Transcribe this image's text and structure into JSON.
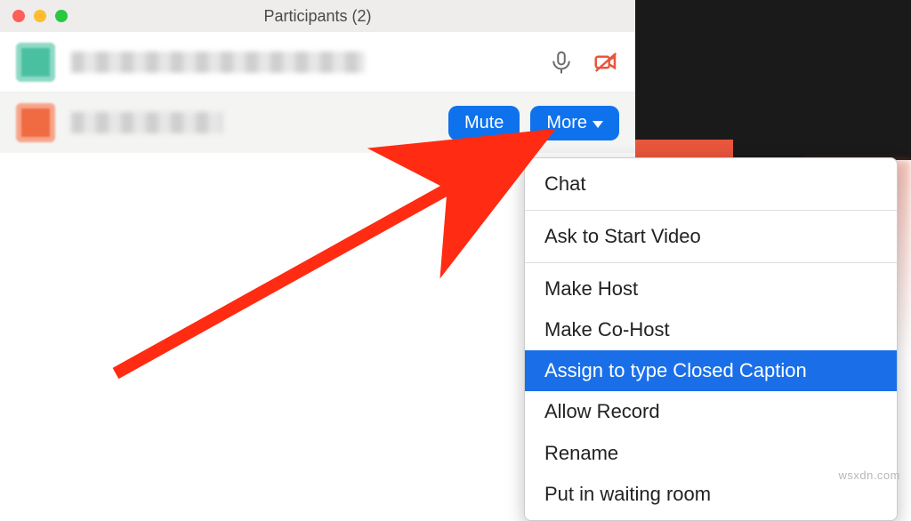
{
  "window": {
    "title": "Participants (2)"
  },
  "participants": [
    {
      "avatar_color": "green",
      "mic_muted": false,
      "video_off": true
    },
    {
      "avatar_color": "orange"
    }
  ],
  "buttons": {
    "mute": "Mute",
    "more": "More"
  },
  "menu": {
    "items": [
      {
        "label": "Chat"
      },
      {
        "label": "Ask to Start Video"
      },
      {
        "label": "Make Host"
      },
      {
        "label": "Make Co-Host"
      },
      {
        "label": "Assign to type Closed Caption",
        "highlighted": true
      },
      {
        "label": "Allow Record"
      },
      {
        "label": "Rename"
      },
      {
        "label": "Put in waiting room"
      }
    ],
    "separators_after": [
      0,
      1
    ]
  },
  "colors": {
    "accent": "#0e72ec",
    "highlight": "#1a6fe8",
    "annotation_arrow": "#ff2b12",
    "video_off": "#e8563c"
  },
  "watermark": "wsxdn.com"
}
